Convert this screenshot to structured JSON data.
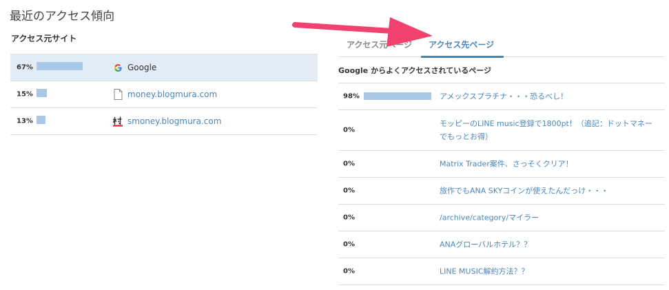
{
  "page": {
    "title": "最近のアクセス傾向"
  },
  "sources": {
    "heading": "アクセス元サイト",
    "rows": [
      {
        "percent": "67%",
        "share": 0.67,
        "icon": "google-icon",
        "label": "Google",
        "selected": true
      },
      {
        "percent": "15%",
        "share": 0.15,
        "icon": "page-icon",
        "label": "money.blogmura.com",
        "selected": false
      },
      {
        "percent": "13%",
        "share": 0.13,
        "icon": "blogmura-icon",
        "label": "smoney.blogmura.com",
        "selected": false
      }
    ]
  },
  "tabs": {
    "items": [
      {
        "label": "アクセス元ページ",
        "active": false
      },
      {
        "label": "アクセス先ページ",
        "active": true
      }
    ]
  },
  "pages": {
    "heading": "Google からよくアクセスされているページ",
    "rows": [
      {
        "percent": "98%",
        "share": 0.98,
        "label": "アメックスプラチナ・・・恐るべし！"
      },
      {
        "percent": "0%",
        "share": 0,
        "label": "モッピーのLINE music登録で1800pt！（追記：ドットマネーでもっとお得）"
      },
      {
        "percent": "0%",
        "share": 0,
        "label": "Matrix Trader案件、さっそくクリア！"
      },
      {
        "percent": "0%",
        "share": 0,
        "label": "旅作でもANA SKYコインが使えたんだっけ・・・"
      },
      {
        "percent": "0%",
        "share": 0,
        "label": "/archive/category/マイラー"
      },
      {
        "percent": "0%",
        "share": 0,
        "label": "ANAグローバルホテル？？"
      },
      {
        "percent": "0%",
        "share": 0,
        "label": "LINE MUSIC解約方法？？"
      }
    ]
  },
  "colors": {
    "accent": "#4a86b8",
    "bar": "#a9c7e6",
    "selected_row": "#e2ecf5",
    "annotation_arrow": "#f0416f"
  }
}
